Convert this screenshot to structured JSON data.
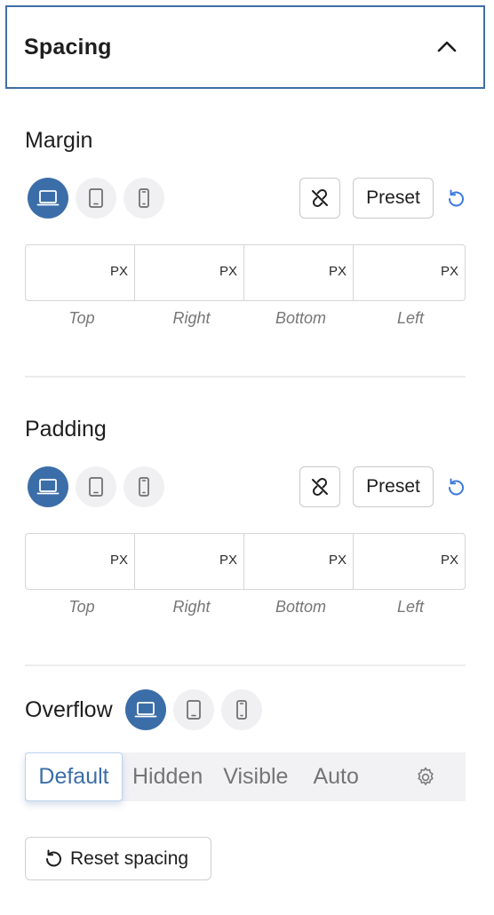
{
  "panel": {
    "title": "Spacing"
  },
  "margin": {
    "title": "Margin",
    "preset_label": "Preset",
    "unit": "PX",
    "fields": [
      {
        "label": "Top",
        "value": ""
      },
      {
        "label": "Right",
        "value": ""
      },
      {
        "label": "Bottom",
        "value": ""
      },
      {
        "label": "Left",
        "value": ""
      }
    ],
    "active_device": "desktop"
  },
  "padding": {
    "title": "Padding",
    "preset_label": "Preset",
    "unit": "PX",
    "fields": [
      {
        "label": "Top",
        "value": ""
      },
      {
        "label": "Right",
        "value": ""
      },
      {
        "label": "Bottom",
        "value": ""
      },
      {
        "label": "Left",
        "value": ""
      }
    ],
    "active_device": "desktop"
  },
  "overflow": {
    "title": "Overflow",
    "options": [
      "Default",
      "Hidden",
      "Visible",
      "Auto"
    ],
    "selected": "Default",
    "active_device": "desktop"
  },
  "reset_button": {
    "label": "Reset spacing"
  },
  "icons": {
    "devices": [
      "desktop-icon",
      "tablet-icon",
      "mobile-icon"
    ],
    "link": "unlink-icon",
    "reset": "undo-icon",
    "settings": "gear-icon",
    "collapse": "chevron-up-icon"
  },
  "colors": {
    "accent": "#3b6ea8",
    "header_border": "#3f6fa6",
    "reset_icon": "#3d7be0"
  }
}
